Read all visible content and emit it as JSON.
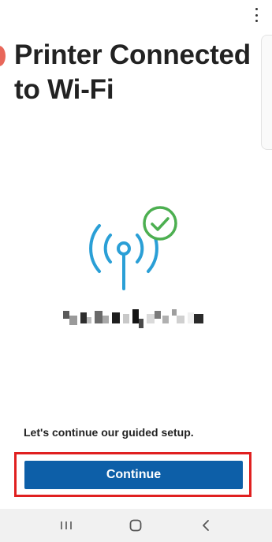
{
  "header": {
    "title": "Printer Connected to Wi-Fi",
    "menu_icon": "more-vertical-icon"
  },
  "graphic": {
    "icon": "wifi-antenna-icon",
    "badge_icon": "checkmark-circle-icon",
    "antenna_color": "#2a9fd6",
    "check_color": "#4caf50"
  },
  "body": {
    "guided_text": "Let's continue our guided setup."
  },
  "actions": {
    "continue_label": "Continue",
    "button_color": "#0d5fa8",
    "highlight_color": "#e02020"
  },
  "nav": {
    "recents_icon": "recent-apps-icon",
    "home_icon": "home-icon",
    "back_icon": "back-icon"
  }
}
